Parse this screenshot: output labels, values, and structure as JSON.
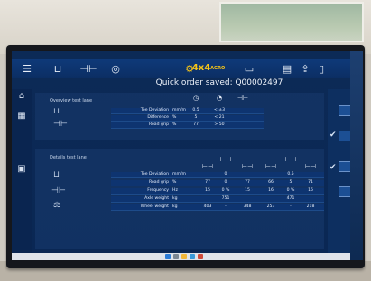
{
  "app": {
    "saved_message": "Quick order saved: Q00002497"
  },
  "toolbar": {
    "icons": [
      "menu-icon",
      "lift-icon",
      "axle-icon",
      "wheel-icon",
      "4x4-icon",
      "printer-icon",
      "list-icon",
      "export-icon",
      "device-icon"
    ],
    "badge_4x4": "4x4",
    "badge_4x4_sub": "AGRO"
  },
  "overview": {
    "title": "Overview test lane",
    "rows": [
      {
        "label": "Toe Deviation",
        "unit": "mm/m",
        "value": "0.5",
        "range": "< ±3"
      },
      {
        "label": "Difference",
        "unit": "%",
        "value": "5",
        "range": "< 21"
      },
      {
        "label": "Road grip",
        "unit": "%",
        "value": "77",
        "range": "> 50"
      }
    ]
  },
  "details": {
    "title": "Details test lane",
    "rows": [
      {
        "label": "Toe Deviation",
        "unit": "mm/m",
        "values": [
          "",
          "0",
          "",
          "",
          "0.5",
          ""
        ]
      },
      {
        "label": "Road grip",
        "unit": "%",
        "values": [
          "77",
          "0",
          "77",
          "66",
          "5",
          "71"
        ]
      },
      {
        "label": "Frequency",
        "unit": "Hz",
        "values": [
          "15",
          "0 %",
          "15",
          "16",
          "0 %",
          "16"
        ]
      },
      {
        "label": "Axle weight",
        "unit": "kg",
        "values": [
          "",
          "751",
          "",
          "",
          "471",
          ""
        ]
      },
      {
        "label": "Wheel weight",
        "unit": "kg",
        "values": [
          "403",
          "-",
          "348",
          "253",
          "-",
          "218"
        ]
      }
    ]
  },
  "colors": {
    "screen_bg": "#0a2754",
    "toolbar_bg": "#0f3a7a",
    "badge": "#f6c518"
  }
}
